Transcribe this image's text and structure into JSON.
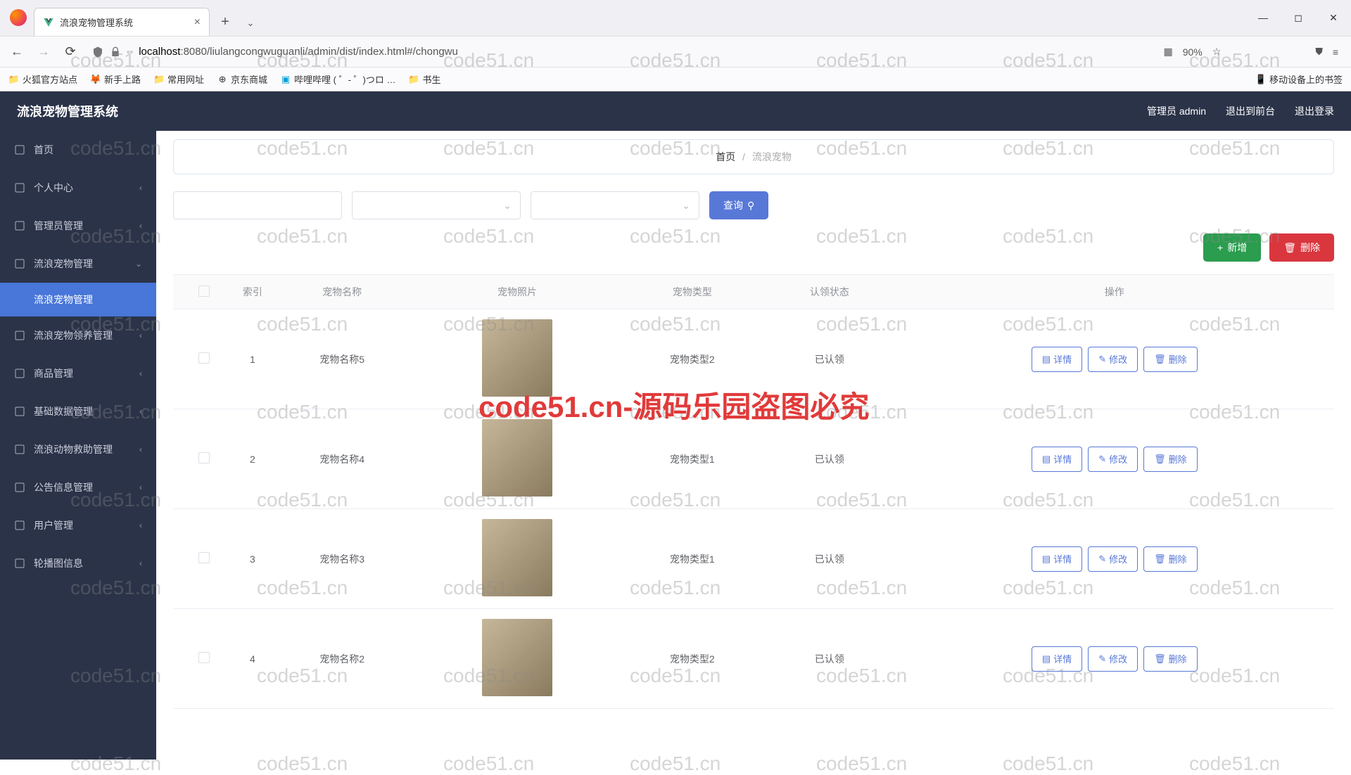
{
  "browser": {
    "tab_title": "流浪宠物管理系统",
    "url_host": "localhost",
    "url_port": ":8080",
    "url_path": "/liulangcongwuguanli/admin/dist/index.html#/chongwu",
    "zoom": "90%",
    "bookmarks": [
      "火狐官方站点",
      "新手上路",
      "常用网址",
      "京东商城",
      "哔哩哔哩 (  ゜- ゜)つロ …",
      "书生"
    ],
    "bookmarks_right": "移动设备上的书签"
  },
  "header": {
    "app_title": "流浪宠物管理系统",
    "admin_label": "管理员 admin",
    "frontend_label": "退出到前台",
    "logout_label": "退出登录"
  },
  "sidebar": {
    "items": [
      {
        "label": "首页",
        "icon": "home",
        "arrow": false
      },
      {
        "label": "个人中心",
        "icon": "user",
        "arrow": true
      },
      {
        "label": "管理员管理",
        "icon": "admin",
        "arrow": true
      },
      {
        "label": "流浪宠物管理",
        "icon": "pet",
        "arrow": true,
        "open": true
      },
      {
        "label": "流浪宠物领养管理",
        "icon": "adopt",
        "arrow": true
      },
      {
        "label": "商品管理",
        "icon": "goods",
        "arrow": true
      },
      {
        "label": "基础数据管理",
        "icon": "data",
        "arrow": true
      },
      {
        "label": "流浪动物救助管理",
        "icon": "rescue",
        "arrow": true
      },
      {
        "label": "公告信息管理",
        "icon": "notice",
        "arrow": true
      },
      {
        "label": "用户管理",
        "icon": "users",
        "arrow": true
      },
      {
        "label": "轮播图信息",
        "icon": "banner",
        "arrow": true
      }
    ],
    "submenu_active": "流浪宠物管理"
  },
  "breadcrumb": {
    "home": "首页",
    "current": "流浪宠物"
  },
  "filters": {
    "search_placeholder": "",
    "select1_placeholder": "",
    "select2_placeholder": "",
    "query_label": "查询"
  },
  "actions": {
    "add_label": "新增",
    "delete_label": "删除"
  },
  "table": {
    "headers": [
      "",
      "索引",
      "宠物名称",
      "宠物照片",
      "宠物类型",
      "认领状态",
      "操作"
    ],
    "row_buttons": {
      "detail": "详情",
      "edit": "修改",
      "delete": "删除"
    },
    "rows": [
      {
        "idx": "1",
        "name": "宠物名称5",
        "photo": "cat",
        "type": "宠物类型2",
        "status": "已认领"
      },
      {
        "idx": "2",
        "name": "宠物名称4",
        "photo": "dog1",
        "type": "宠物类型1",
        "status": "已认领"
      },
      {
        "idx": "3",
        "name": "宠物名称3",
        "photo": "dog2",
        "type": "宠物类型1",
        "status": "已认领"
      },
      {
        "idx": "4",
        "name": "宠物名称2",
        "photo": "dog3",
        "type": "宠物类型2",
        "status": "已认领"
      }
    ]
  },
  "watermark_text": "code51.cn",
  "watermark_red": "code51.cn-源码乐园盗图必究"
}
